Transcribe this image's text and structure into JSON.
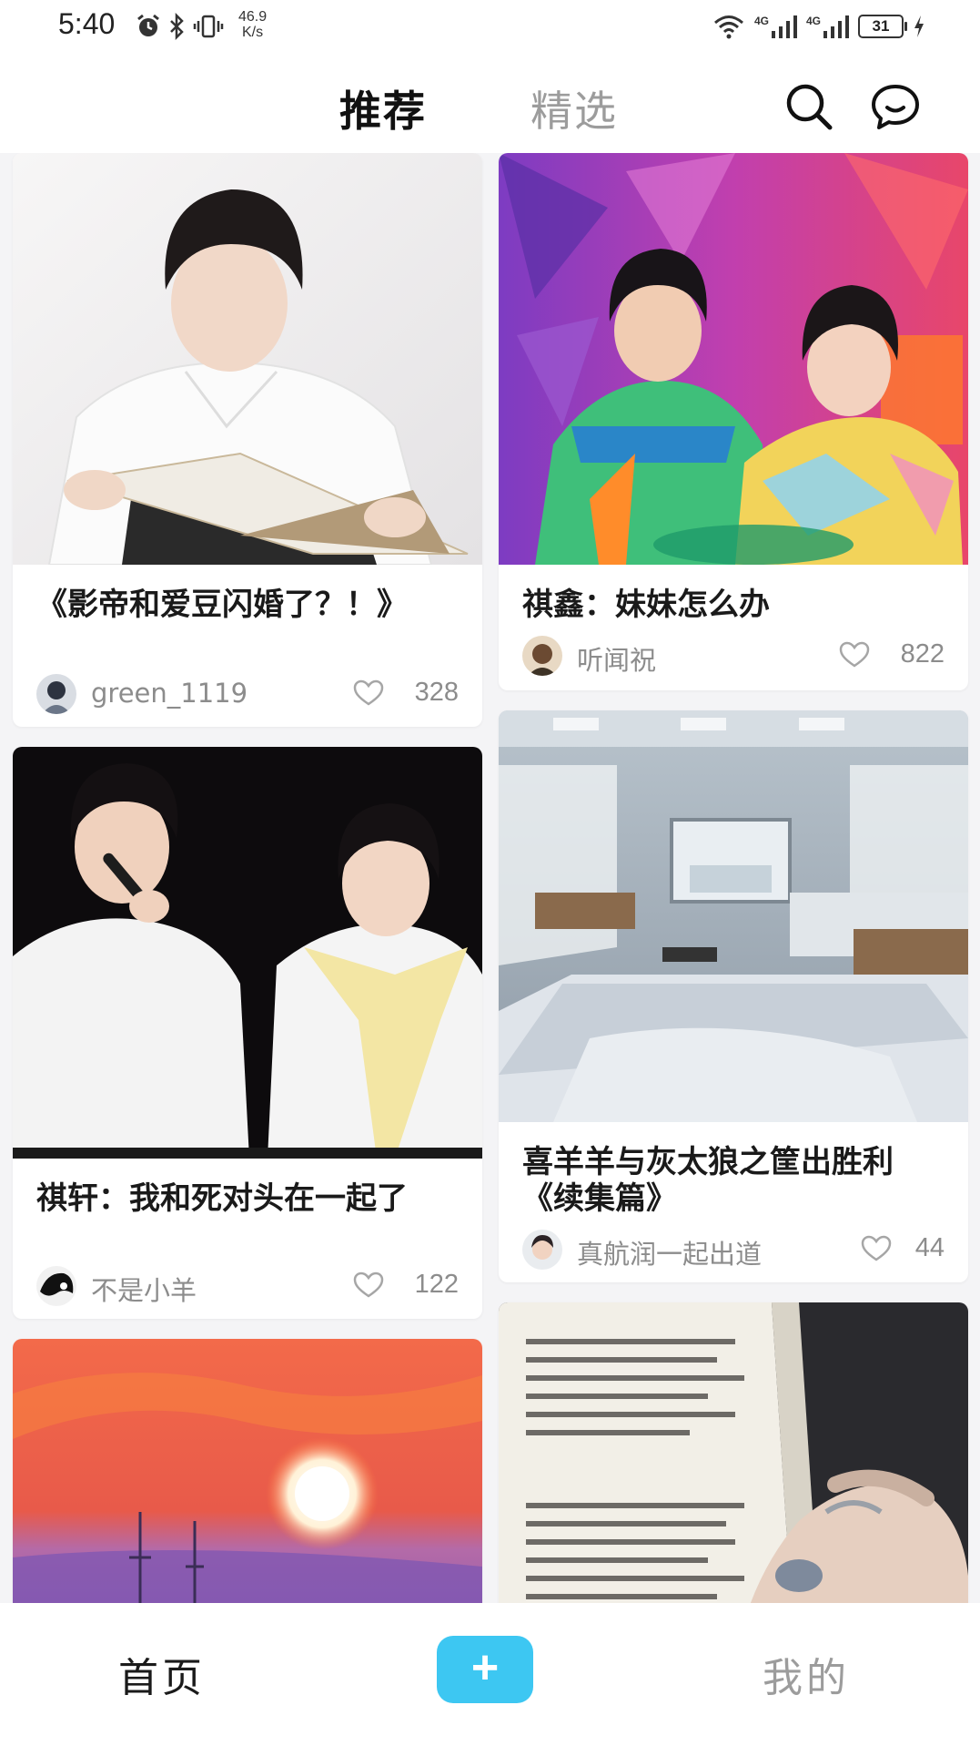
{
  "status_bar": {
    "time": "5:40",
    "net_speed_value": "46.9",
    "net_speed_unit": "K/s",
    "signal_1_label": "4G",
    "signal_2_label": "4G",
    "battery": "31"
  },
  "header": {
    "tab_recommend": "推荐",
    "tab_featured": "精选",
    "active_tab": "推荐",
    "accent_color": "#3dc7f2"
  },
  "feed": {
    "cards": [
      {
        "title": "《影帝和爱豆闪婚了？！》",
        "author": "green_1119",
        "likes": "328",
        "image": "young man in white shirt reading a magazine"
      },
      {
        "title": "祺鑫：妹妹怎么办",
        "author": "听闻祝",
        "likes": "822",
        "image": "two young men at colorful game show stage"
      },
      {
        "title": "祺轩：我和死对头在一起了",
        "author": "不是小羊",
        "likes": "122",
        "image": "two young men in white t-shirts on stage"
      },
      {
        "title": "喜羊羊与灰太狼之筐出胜利《续集篇》",
        "author": "真航润一起出道",
        "likes": "44",
        "image": "anime-style dormitory room with beds"
      },
      {
        "title": "",
        "image": "painted sunset with orange sun and purple sea"
      },
      {
        "title": "",
        "image": "hand holding an open book"
      }
    ]
  },
  "bottom_nav": {
    "home": "首页",
    "add": "+",
    "mine": "我的"
  }
}
